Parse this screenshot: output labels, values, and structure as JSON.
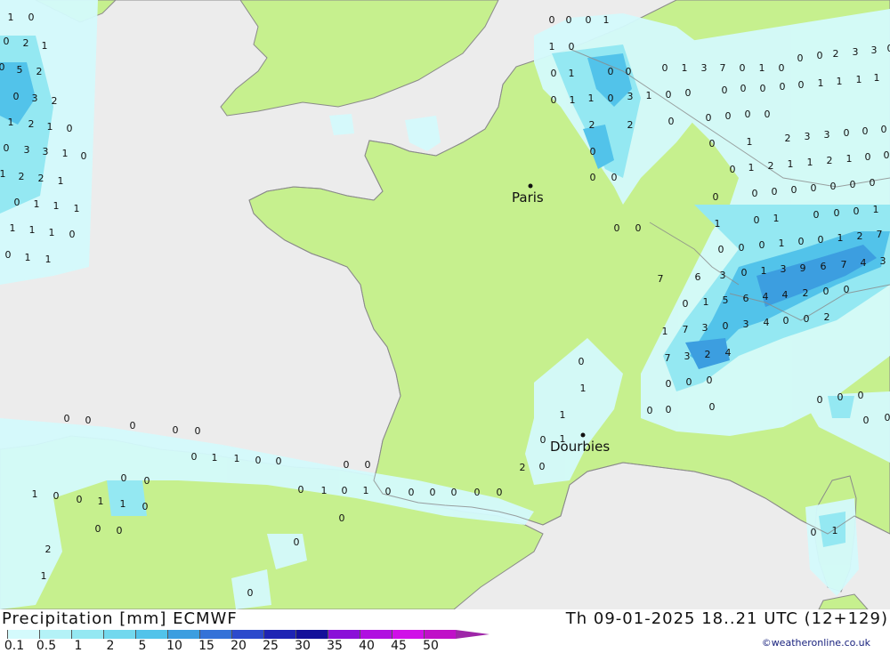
{
  "map": {
    "cities": [
      {
        "name": "Paris"
      },
      {
        "name": "Dourbies"
      }
    ],
    "values": [
      "1",
      "0",
      "0",
      "2",
      "1",
      "0",
      "5",
      "2",
      "0",
      "3",
      "2",
      "1",
      "2",
      "1",
      "0",
      "0",
      "3",
      "3",
      "1",
      "0",
      "1",
      "2",
      "2",
      "1",
      "0",
      "1",
      "1",
      "1",
      "1",
      "1",
      "1",
      "0",
      "0",
      "1",
      "1",
      "0",
      "0",
      "0",
      "1",
      "1",
      "0",
      "0",
      "1",
      "0",
      "0",
      "0",
      "1",
      "3",
      "7",
      "0",
      "1",
      "0",
      "0",
      "0",
      "2",
      "3",
      "3",
      "0",
      "0",
      "1",
      "1",
      "0",
      "3",
      "1",
      "0",
      "0",
      "0",
      "0",
      "0",
      "0",
      "0",
      "1",
      "1",
      "1",
      "1",
      "2",
      "2",
      "0",
      "0",
      "0",
      "0",
      "0",
      "0",
      "0",
      "1",
      "2",
      "3",
      "3",
      "0",
      "0",
      "0",
      "0",
      "0",
      "0",
      "1",
      "2",
      "1",
      "1",
      "2",
      "1",
      "0",
      "0",
      "0",
      "0",
      "0",
      "0",
      "0",
      "0",
      "0",
      "0",
      "0",
      "0",
      "1",
      "0",
      "1",
      "0",
      "0",
      "0",
      "1",
      "0",
      "0",
      "0",
      "1",
      "0",
      "0",
      "1",
      "2",
      "7",
      "7",
      "6",
      "3",
      "0",
      "1",
      "3",
      "9",
      "6",
      "7",
      "4",
      "3",
      "0",
      "1",
      "5",
      "6",
      "4",
      "4",
      "2",
      "0",
      "0",
      "1",
      "7",
      "3",
      "0",
      "3",
      "4",
      "0",
      "0",
      "2",
      "7",
      "3",
      "2",
      "4",
      "0",
      "0",
      "0",
      "0",
      "1",
      "1",
      "0",
      "1",
      "2",
      "0",
      "0",
      "0",
      "0",
      "0",
      "0",
      "0",
      "0",
      "0",
      "0",
      "0",
      "0",
      "0",
      "0",
      "0",
      "1",
      "1",
      "0",
      "0",
      "0",
      "0",
      "0",
      "0",
      "0",
      "1",
      "0",
      "1",
      "0",
      "0",
      "0",
      "0",
      "0",
      "0",
      "1",
      "0",
      "0",
      "1",
      "1",
      "0",
      "0",
      "0",
      "0",
      "0",
      "2",
      "1",
      "0",
      "0",
      "1"
    ]
  },
  "footer": {
    "title": "Precipitation [mm] ECMWF",
    "datetime": "Th 09-01-2025 18..21 UTC (12+129)",
    "credit": "©weatheronline.co.uk"
  },
  "legend": {
    "labels": [
      "0.1",
      "0.5",
      "1",
      "2",
      "5",
      "10",
      "15",
      "20",
      "25",
      "30",
      "35",
      "40",
      "45",
      "50"
    ],
    "colors": [
      "#d4fafc",
      "#b4f2f7",
      "#94e8f2",
      "#72d8ee",
      "#52c3ea",
      "#3c9ee0",
      "#3472d8",
      "#2c4acc",
      "#1e24b4",
      "#14109a",
      "#8a10d8",
      "#b010e0",
      "#d010e8",
      "#c010c8"
    ],
    "arrow_color": "#9e26a8"
  },
  "colors": {
    "sea": "#ececec",
    "land": "#c6f08e",
    "coast": "#888888"
  }
}
